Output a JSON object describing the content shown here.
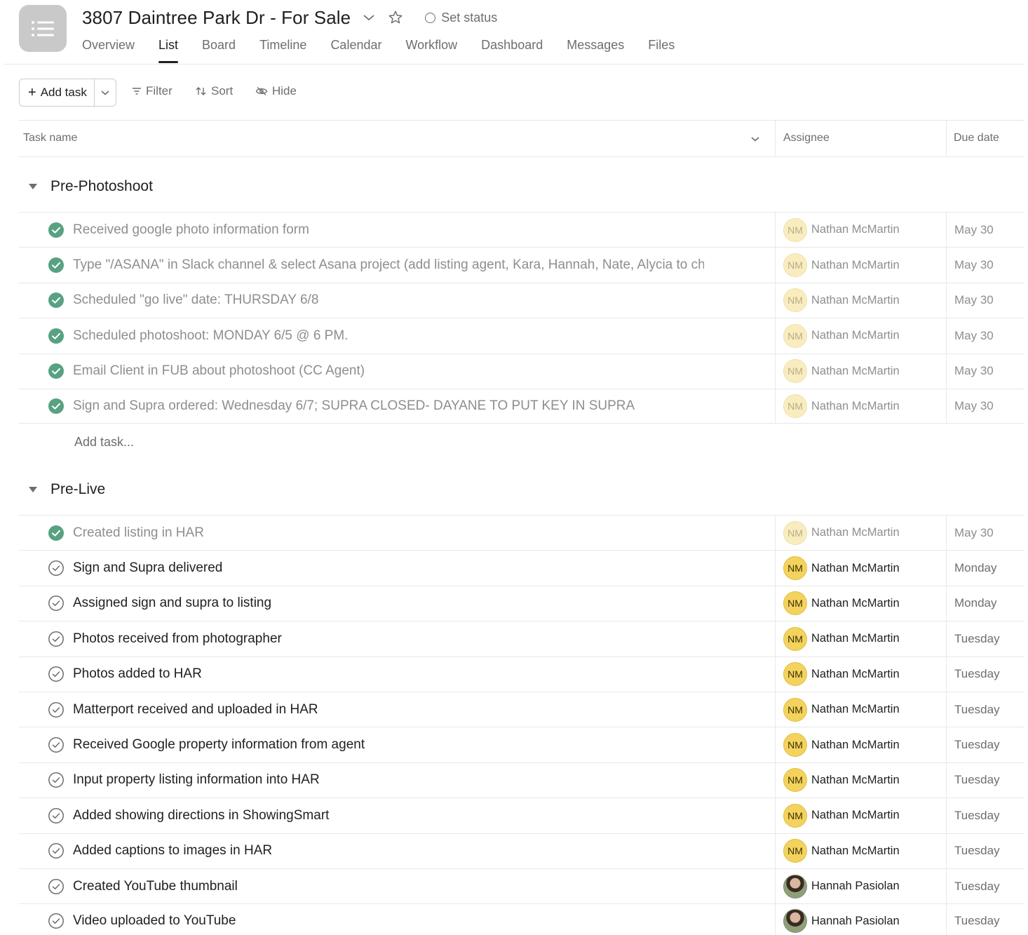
{
  "header": {
    "title": "3807 Daintree Park Dr - For Sale",
    "set_status": "Set status"
  },
  "tabs": [
    {
      "label": "Overview",
      "active": false
    },
    {
      "label": "List",
      "active": true
    },
    {
      "label": "Board",
      "active": false
    },
    {
      "label": "Timeline",
      "active": false
    },
    {
      "label": "Calendar",
      "active": false
    },
    {
      "label": "Workflow",
      "active": false
    },
    {
      "label": "Dashboard",
      "active": false
    },
    {
      "label": "Messages",
      "active": false
    },
    {
      "label": "Files",
      "active": false
    }
  ],
  "toolbar": {
    "add_task": "Add task",
    "filter": "Filter",
    "sort": "Sort",
    "hide": "Hide"
  },
  "columns": {
    "task_name": "Task name",
    "assignee": "Assignee",
    "due_date": "Due date"
  },
  "sections": [
    {
      "name": "Pre-Photoshoot",
      "add_task": "Add task...",
      "tasks": [
        {
          "name": "Received google photo information form",
          "done": true,
          "assignee": "Nathan McMartin",
          "initials": "NM",
          "due": "May 30"
        },
        {
          "name": "Type \"/ASANA\" in Slack channel & select Asana project (add listing agent, Kara, Hannah, Nate, Alycia to channel)",
          "done": true,
          "assignee": "Nathan McMartin",
          "initials": "NM",
          "due": "May 30"
        },
        {
          "name": "Scheduled \"go live\" date: THURSDAY 6/8",
          "done": true,
          "assignee": "Nathan McMartin",
          "initials": "NM",
          "due": "May 30"
        },
        {
          "name": "Scheduled photoshoot: MONDAY 6/5 @ 6 PM.",
          "done": true,
          "assignee": "Nathan McMartin",
          "initials": "NM",
          "due": "May 30"
        },
        {
          "name": "Email Client in FUB about photoshoot (CC Agent)",
          "done": true,
          "assignee": "Nathan McMartin",
          "initials": "NM",
          "due": "May 30"
        },
        {
          "name": "Sign and Supra ordered: Wednesday 6/7; SUPRA CLOSED- DAYANE TO PUT KEY IN SUPRA",
          "done": true,
          "assignee": "Nathan McMartin",
          "initials": "NM",
          "due": "May 30"
        }
      ]
    },
    {
      "name": "Pre-Live",
      "tasks": [
        {
          "name": "Created listing in HAR",
          "done": true,
          "assignee": "Nathan McMartin",
          "initials": "NM",
          "due": "May 30"
        },
        {
          "name": "Sign and Supra delivered",
          "done": false,
          "assignee": "Nathan McMartin",
          "initials": "NM",
          "due": "Monday"
        },
        {
          "name": "Assigned sign and supra to listing",
          "done": false,
          "assignee": "Nathan McMartin",
          "initials": "NM",
          "due": "Monday"
        },
        {
          "name": "Photos received from photographer",
          "done": false,
          "assignee": "Nathan McMartin",
          "initials": "NM",
          "due": "Tuesday"
        },
        {
          "name": "Photos added to HAR",
          "done": false,
          "assignee": "Nathan McMartin",
          "initials": "NM",
          "due": "Tuesday"
        },
        {
          "name": "Matterport received and uploaded in HAR",
          "done": false,
          "assignee": "Nathan McMartin",
          "initials": "NM",
          "due": "Tuesday"
        },
        {
          "name": "Received Google property information from agent",
          "done": false,
          "assignee": "Nathan McMartin",
          "initials": "NM",
          "due": "Tuesday"
        },
        {
          "name": "Input property listing information into HAR",
          "done": false,
          "assignee": "Nathan McMartin",
          "initials": "NM",
          "due": "Tuesday"
        },
        {
          "name": "Added showing directions in ShowingSmart",
          "done": false,
          "assignee": "Nathan McMartin",
          "initials": "NM",
          "due": "Tuesday"
        },
        {
          "name": "Added captions to images in HAR",
          "done": false,
          "assignee": "Nathan McMartin",
          "initials": "NM",
          "due": "Tuesday"
        },
        {
          "name": "Created YouTube thumbnail",
          "done": false,
          "assignee": "Hannah Pasiolan",
          "initials": "",
          "due": "Tuesday",
          "photo": true
        },
        {
          "name": "Video uploaded to YouTube",
          "done": false,
          "assignee": "Hannah Pasiolan",
          "initials": "",
          "due": "Tuesday",
          "photo": true
        }
      ]
    }
  ],
  "colors": {
    "check_done": "#58a182",
    "avatar_yellow": "#f3d35e"
  }
}
